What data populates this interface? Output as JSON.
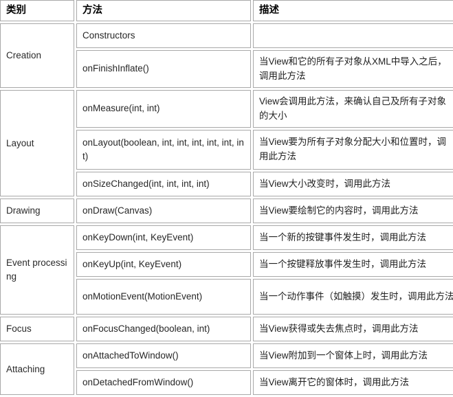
{
  "table": {
    "headers": {
      "category": "类别",
      "method": "方法",
      "description": "描述"
    },
    "categories": [
      {
        "name": "Creation",
        "rows": [
          {
            "method": "Constructors",
            "description": ""
          },
          {
            "method": "onFinishInflate()",
            "description": "当View和它的所有子对象从XML中导入之后，调用此方法"
          }
        ]
      },
      {
        "name": "Layout",
        "rows": [
          {
            "method": "onMeasure(int, int)",
            "description": "View会调用此方法，来确认自己及所有子对象的大小"
          },
          {
            "method": "onLayout(boolean, int, int, int, int, int, int)",
            "description": "当View要为所有子对象分配大小和位置时，调用此方法"
          },
          {
            "method": "onSizeChanged(int, int, int, int)",
            "description": "当View大小改变时，调用此方法"
          }
        ]
      },
      {
        "name": "Drawing",
        "rows": [
          {
            "method": "onDraw(Canvas)",
            "description": "当View要绘制它的内容时，调用此方法"
          }
        ]
      },
      {
        "name": "Event processing",
        "rows": [
          {
            "method": "onKeyDown(int, KeyEvent)",
            "description": "当一个新的按键事件发生时，调用此方法"
          },
          {
            "method": "onKeyUp(int, KeyEvent)",
            "description": "当一个按键释放事件发生时，调用此方法"
          },
          {
            "method": "onMotionEvent(MotionEvent)",
            "description": "当一个动作事件（如触摸）发生时，调用此方法"
          }
        ]
      },
      {
        "name": "Focus",
        "rows": [
          {
            "method": "onFocusChanged(boolean, int)",
            "description": "当View获得或失去焦点时，调用此方法"
          }
        ]
      },
      {
        "name": "Attaching",
        "rows": [
          {
            "method": "onAttachedToWindow()",
            "description": "当View附加到一个窗体上时，调用此方法"
          },
          {
            "method": "onDetachedFromWindow()",
            "description": "当View离开它的窗体时，调用此方法"
          }
        ]
      }
    ],
    "colors": {
      "border": "#a8a8a8",
      "background": "#ffffff",
      "text": "#1f1f1f"
    }
  }
}
